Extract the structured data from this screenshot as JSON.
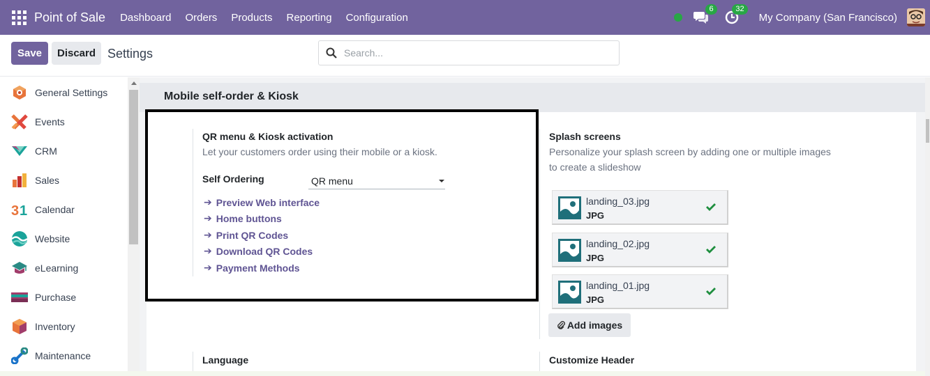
{
  "navbar": {
    "app_name": "Point of Sale",
    "menu": [
      "Dashboard",
      "Orders",
      "Products",
      "Reporting",
      "Configuration"
    ],
    "messages_count": "6",
    "activities_count": "32",
    "company": "My Company (San Francisco)",
    "colors": {
      "bar": "#71639e",
      "badge": "#28a745"
    }
  },
  "control_panel": {
    "save_label": "Save",
    "discard_label": "Discard",
    "title": "Settings",
    "search_placeholder": "Search..."
  },
  "sidebar": {
    "items": [
      {
        "label": "General Settings",
        "icon": "general-settings-icon"
      },
      {
        "label": "Events",
        "icon": "events-icon"
      },
      {
        "label": "CRM",
        "icon": "crm-icon"
      },
      {
        "label": "Sales",
        "icon": "sales-icon"
      },
      {
        "label": "Calendar",
        "icon": "calendar-icon"
      },
      {
        "label": "Website",
        "icon": "website-icon"
      },
      {
        "label": "eLearning",
        "icon": "elearning-icon"
      },
      {
        "label": "Purchase",
        "icon": "purchase-icon"
      },
      {
        "label": "Inventory",
        "icon": "inventory-icon"
      },
      {
        "label": "Maintenance",
        "icon": "maintenance-icon"
      }
    ]
  },
  "section": {
    "title": "Mobile self-order & Kiosk",
    "qr": {
      "title": "QR menu & Kiosk activation",
      "desc": "Let your customers order using their mobile or a kiosk.",
      "field_label": "Self Ordering",
      "field_value": "QR menu",
      "links": [
        "Preview Web interface",
        "Home buttons",
        "Print QR Codes",
        "Download QR Codes",
        "Payment Methods"
      ]
    },
    "splash": {
      "title": "Splash screens",
      "desc_line1": "Personalize your splash screen by adding one or multiple images",
      "desc_line2": "to create a slideshow",
      "files": [
        {
          "name": "landing_03.jpg",
          "type": "JPG"
        },
        {
          "name": "landing_02.jpg",
          "type": "JPG"
        },
        {
          "name": "landing_01.jpg",
          "type": "JPG"
        }
      ],
      "add_label": "Add images"
    },
    "language_title": "Language",
    "header_title": "Customize Header"
  }
}
